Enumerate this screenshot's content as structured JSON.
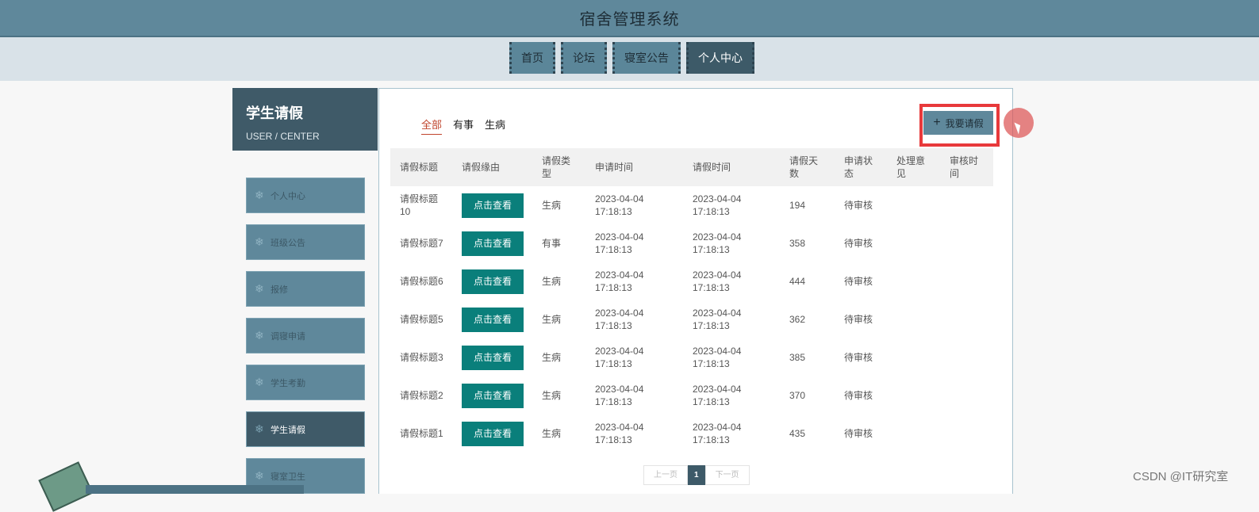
{
  "header": {
    "title": "宿舍管理系统"
  },
  "nav": [
    {
      "label": "首页",
      "active": false
    },
    {
      "label": "论坛",
      "active": false
    },
    {
      "label": "寝室公告",
      "active": false
    },
    {
      "label": "个人中心",
      "active": true
    }
  ],
  "sidebar": {
    "title": "学生请假",
    "subtitle": "USER / CENTER",
    "items": [
      {
        "label": "个人中心",
        "active": false
      },
      {
        "label": "班级公告",
        "active": false
      },
      {
        "label": "报修",
        "active": false
      },
      {
        "label": "调寝申请",
        "active": false
      },
      {
        "label": "学生考勤",
        "active": false
      },
      {
        "label": "学生请假",
        "active": true
      },
      {
        "label": "寝室卫生",
        "active": false
      }
    ]
  },
  "filters": [
    {
      "label": "全部",
      "active": true
    },
    {
      "label": "有事",
      "active": false
    },
    {
      "label": "生病",
      "active": false
    }
  ],
  "add_button": {
    "icon": "plus-icon",
    "label": "我要请假"
  },
  "table": {
    "columns": [
      "请假标题",
      "请假缘由",
      "请假类型",
      "申请时间",
      "请假时间",
      "请假天数",
      "申请状态",
      "处理意见",
      "审核时间"
    ],
    "view_label": "点击查看",
    "rows": [
      {
        "title": "请假标题10",
        "type": "生病",
        "apply_time": "2023-04-04 17:18:13",
        "leave_time": "2023-04-04 17:18:13",
        "days": "194",
        "status": "待审核",
        "opinion": "",
        "review_time": ""
      },
      {
        "title": "请假标题7",
        "type": "有事",
        "apply_time": "2023-04-04 17:18:13",
        "leave_time": "2023-04-04 17:18:13",
        "days": "358",
        "status": "待审核",
        "opinion": "",
        "review_time": ""
      },
      {
        "title": "请假标题6",
        "type": "生病",
        "apply_time": "2023-04-04 17:18:13",
        "leave_time": "2023-04-04 17:18:13",
        "days": "444",
        "status": "待审核",
        "opinion": "",
        "review_time": ""
      },
      {
        "title": "请假标题5",
        "type": "生病",
        "apply_time": "2023-04-04 17:18:13",
        "leave_time": "2023-04-04 17:18:13",
        "days": "362",
        "status": "待审核",
        "opinion": "",
        "review_time": ""
      },
      {
        "title": "请假标题3",
        "type": "生病",
        "apply_time": "2023-04-04 17:18:13",
        "leave_time": "2023-04-04 17:18:13",
        "days": "385",
        "status": "待审核",
        "opinion": "",
        "review_time": ""
      },
      {
        "title": "请假标题2",
        "type": "生病",
        "apply_time": "2023-04-04 17:18:13",
        "leave_time": "2023-04-04 17:18:13",
        "days": "370",
        "status": "待审核",
        "opinion": "",
        "review_time": ""
      },
      {
        "title": "请假标题1",
        "type": "生病",
        "apply_time": "2023-04-04 17:18:13",
        "leave_time": "2023-04-04 17:18:13",
        "days": "435",
        "status": "待审核",
        "opinion": "",
        "review_time": ""
      }
    ]
  },
  "pager": {
    "prev": "上一页",
    "current": "1",
    "next": "下一页"
  },
  "watermark": "CSDN @IT研究室",
  "colors": {
    "header": "#5f889b",
    "sidebar_active": "#3f5a68",
    "view_button": "#0a7f7b",
    "highlight": "#e8393b",
    "filter_active": "#c0442c"
  }
}
